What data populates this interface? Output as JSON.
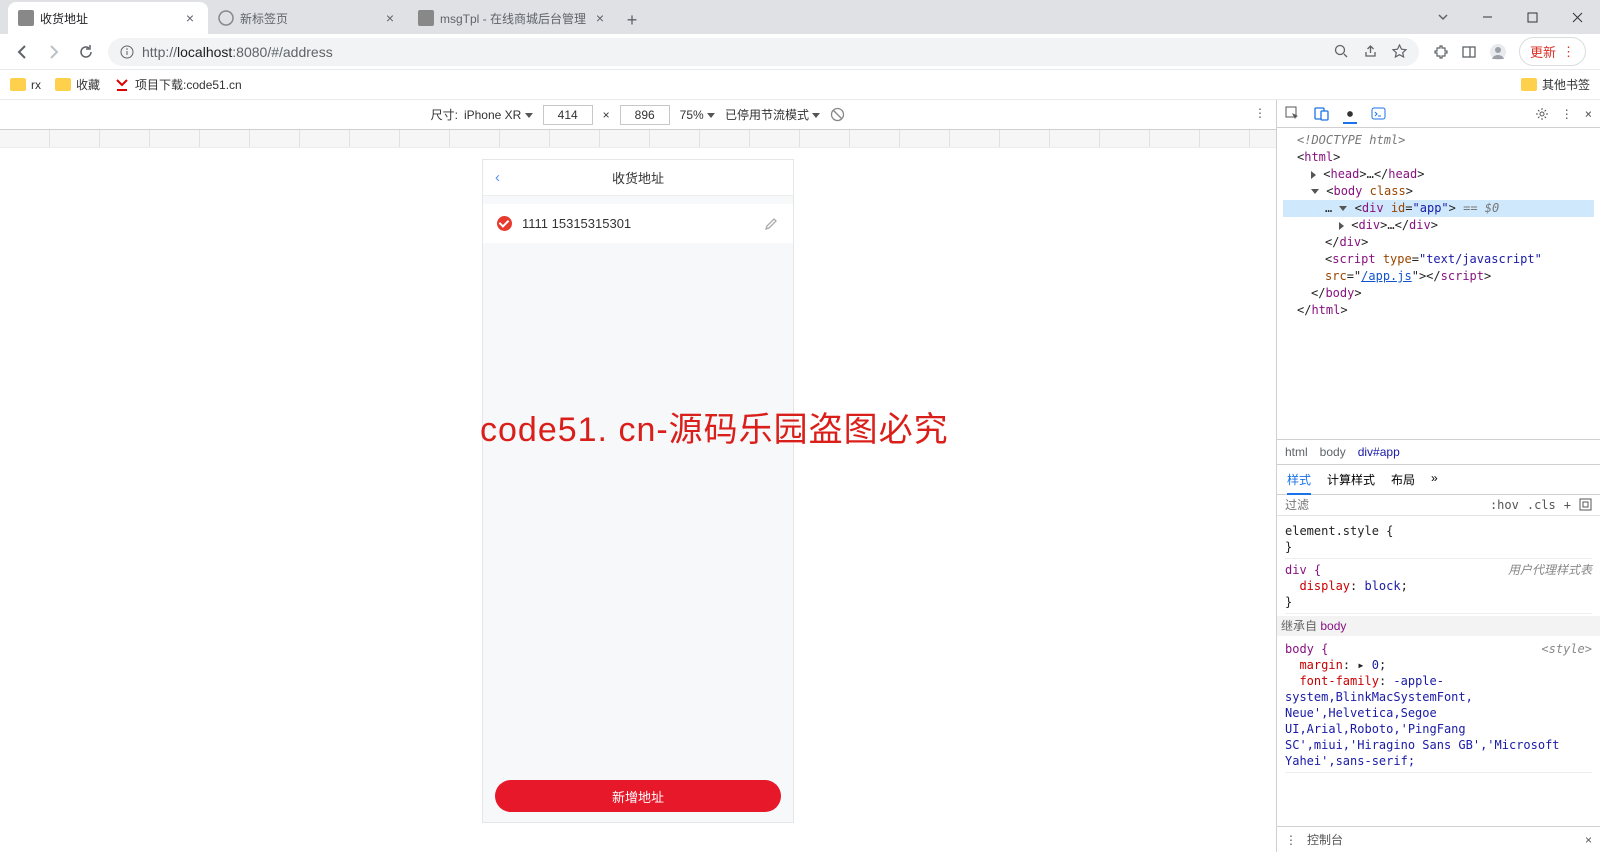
{
  "tabs": [
    {
      "title": "收货地址"
    },
    {
      "title": "新标签页"
    },
    {
      "title": "msgTpl - 在线商城后台管理"
    }
  ],
  "url": {
    "prefix": "http://",
    "host": "localhost",
    "rest": ":8080/#/address"
  },
  "update_label": "更新",
  "bookmarks": {
    "rx": "rx",
    "fav": "收藏",
    "dl": "项目下载:code51.cn",
    "other": "其他书签"
  },
  "device_bar": {
    "size_label": "尺寸:",
    "device": "iPhone XR",
    "w": "414",
    "h": "896",
    "times": "×",
    "zoom": "75%",
    "throttle": "已停用节流模式"
  },
  "phone": {
    "title": "收货地址",
    "item_text": "1111 15315315301",
    "add_btn": "新增地址"
  },
  "watermark": "code51. cn-源码乐园盗图必究",
  "dom": {
    "doctype": "<!DOCTYPE html>",
    "html_o": "<",
    "html_t": "html",
    "html_c": ">",
    "head_o": "<",
    "head_t": "head",
    "head_dots": ">…</",
    "head_end": ">",
    "body_o": "<",
    "body_t": "body",
    "body_attr": " class",
    "body_c": ">",
    "div_app": "div",
    "id_attr": "id",
    "id_v": "\"app\"",
    "eq0": " == $0",
    "inner_div": "div",
    "inner_dots": ">…</",
    "inner_end": ">",
    "cdiv": "</",
    "cdiv_t": "div",
    "cdiv_e": ">",
    "script_o": "<",
    "script_t": "script",
    "type_a": "type",
    "type_v": "\"text/javascript\"",
    "src_a": "src",
    "src_v": "/app.js",
    "script_c": "></",
    "script_e": ">",
    "cbody": "</",
    "cbody_t": "body",
    "cbody_e": ">",
    "chtml": "</",
    "chtml_t": "html",
    "chtml_e": ">"
  },
  "breadcrumbs": {
    "html": "html",
    "body": "body",
    "app": "div#app"
  },
  "style_tabs": {
    "s": "样式",
    "c": "计算样式",
    "l": "布局",
    "more": "»"
  },
  "filter": {
    "ph": "过滤",
    "hov": ":hov",
    "cls": ".cls",
    "plus": "+"
  },
  "css": {
    "es": "element.style {",
    "brace": "}",
    "div": "div {",
    "ua": "用户代理样式表",
    "display_p": "display",
    "display_v": "block",
    "inherit": "继承自 ",
    "inherit_from": "body",
    "body_rule": "body {",
    "style_src": "<style>",
    "margin_p": "margin",
    "margin_v": "0",
    "ff_p": "font-family",
    "ff_v": "-apple-system,BlinkMacSystemFont, Neue',Helvetica,Segoe UI,Arial,Roboto,'PingFang SC',miui,'Hiragino Sans GB','Microsoft Yahei',sans-serif;"
  },
  "drawer": {
    "console": "控制台"
  }
}
